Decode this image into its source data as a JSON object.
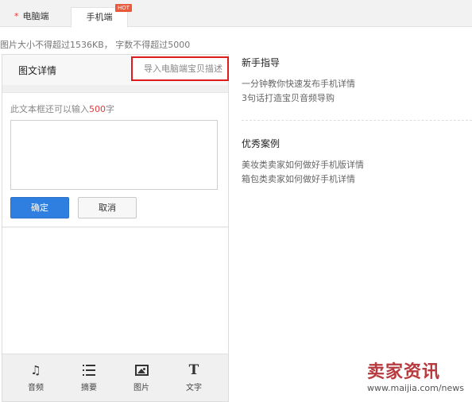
{
  "tabs": {
    "required_mark": "*",
    "pc_label": "电脑端",
    "mobile_label": "手机端",
    "hot_badge": "HOT"
  },
  "size_hint": "图片大小不得超过1536KB， 字数不得超过5000",
  "editor": {
    "title": "图文详情",
    "import_button": "导入电脑端宝贝描述",
    "char_hint_prefix": "此文本框还可以输入",
    "char_hint_count": "500",
    "char_hint_suffix": "字",
    "textarea_value": "",
    "ok_button": "确定",
    "cancel_button": "取消"
  },
  "toolbar": {
    "items": [
      {
        "label": "音频",
        "icon": "music-note-icon"
      },
      {
        "label": "摘要",
        "icon": "list-icon"
      },
      {
        "label": "图片",
        "icon": "image-icon"
      },
      {
        "label": "文字",
        "icon": "text-icon",
        "glyph": "T"
      }
    ],
    "audio_glyph": "♫"
  },
  "guide": {
    "title": "新手指导",
    "links": [
      "一分钟教你快速发布手机详情",
      "3句话打造宝贝音频导购"
    ]
  },
  "cases": {
    "title": "优秀案例",
    "links": [
      "美妆类卖家如何做好手机版详情",
      "箱包类卖家如何做好手机详情"
    ]
  },
  "watermark": {
    "logo_text": "卖家资讯",
    "url": "www.maijia.com/news"
  },
  "colors": {
    "accent_blue": "#2f7fe0",
    "highlight_red": "#e01b1b",
    "count_red": "#e4393c",
    "watermark_red": "#b73a3e"
  }
}
